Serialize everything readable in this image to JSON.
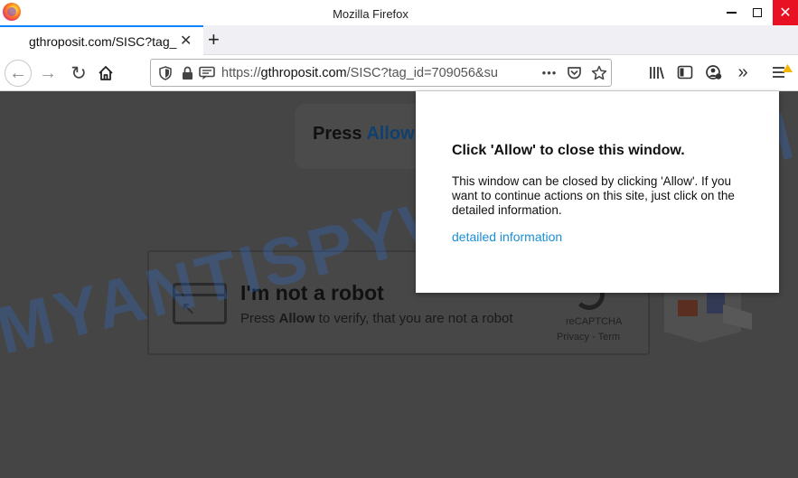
{
  "window": {
    "title": "Mozilla Firefox",
    "minimize_label": "",
    "close_label": "✕"
  },
  "tab": {
    "title": "gthroposit.com/SISC?tag_",
    "close": "✕",
    "new_tab": "+"
  },
  "navbar": {
    "url_prefix": "https://",
    "url_domain": "gthroposit.com",
    "url_rest": "/SISC?tag_id=709056&su",
    "more": "•••"
  },
  "page": {
    "press_prefix": "Press ",
    "press_allow": "Allow",
    "robot_title": "I'm not a robot",
    "robot_sub_pre": "Press ",
    "robot_sub_bold": "Allow",
    "robot_sub_post": " to verify, that you are not a robot",
    "recaptcha": "reCAPTCHA",
    "recaptcha_links": "Privacy - Term"
  },
  "popup": {
    "title": "Click 'Allow' to close this window.",
    "body": "This window can be closed by clicking 'Allow'. If you want to continue actions on this site, just click on the detailed information.",
    "link": "detailed information"
  },
  "watermark": "MYANTISPYWARE.COM",
  "colors": {
    "tab_accent": "#0a84ff",
    "close_red": "#e81123",
    "page_bg": "#454545",
    "link_blue": "#1a8fd6"
  }
}
